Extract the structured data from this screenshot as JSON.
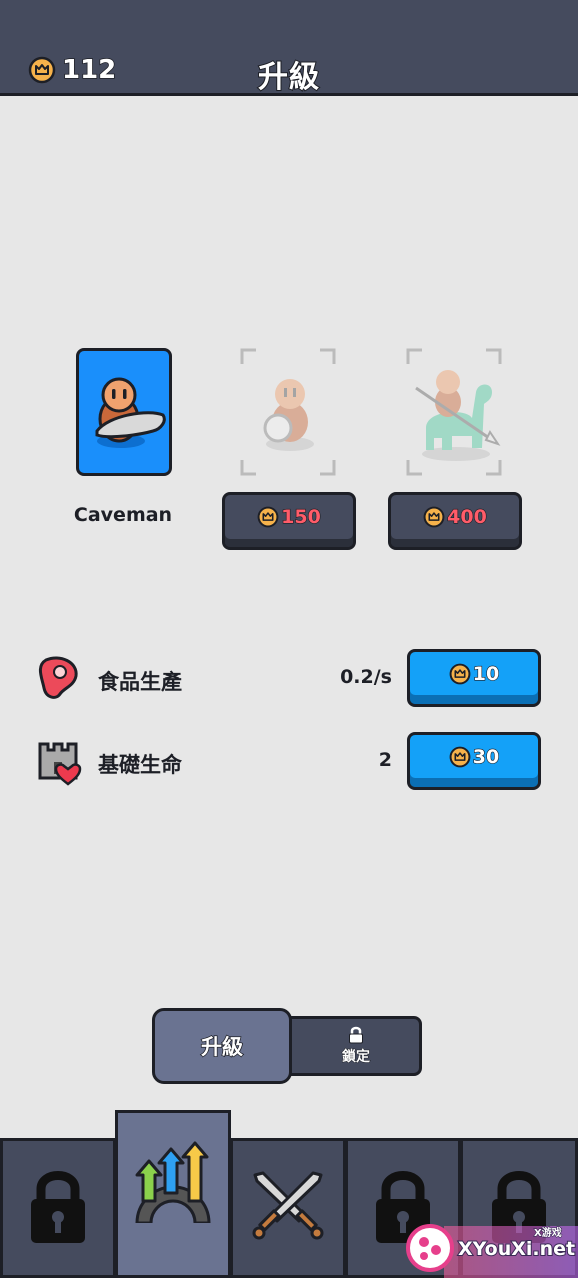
{
  "header": {
    "coins": "112",
    "title": "升級"
  },
  "units": [
    {
      "name": "Caveman",
      "state": "owned"
    },
    {
      "price": "150",
      "state": "locked"
    },
    {
      "price": "400",
      "state": "locked"
    }
  ],
  "stats": [
    {
      "icon": "meat-icon",
      "label": "食品生產",
      "value": "0.2/s",
      "cost": "10"
    },
    {
      "icon": "castle-heart-icon",
      "label": "基礎生命",
      "value": "2",
      "cost": "30"
    }
  ],
  "toggle": {
    "upgrade_label": "升級",
    "locked_label": "鎖定"
  },
  "nav": [
    "lock-icon",
    "upgrade-arrows-icon",
    "crossed-swords-icon",
    "lock-icon",
    "lock-icon"
  ],
  "watermark": {
    "brand": "XYouXi.net",
    "small": "X游戏"
  },
  "colors": {
    "header": "#454b5e",
    "accent_blue": "#1a8ffb",
    "price_red": "#ff5c69",
    "coin": "#f6b24b"
  }
}
